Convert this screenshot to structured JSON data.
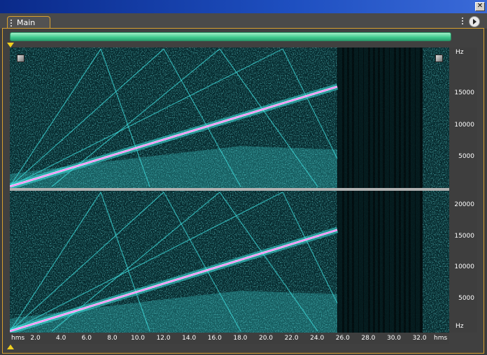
{
  "window": {
    "close_glyph": "✕"
  },
  "tabs": [
    {
      "label": "Main"
    }
  ],
  "colors": {
    "accent": "#d8a030",
    "overview": "#3ec88c",
    "spectro_bg": "#052226",
    "signal": "#3fe0e0",
    "sweep": "#ff60ff"
  },
  "icons": {
    "close": "close-icon",
    "panel_menu": "play-circle-icon",
    "grip": "grip-icon"
  },
  "frequency_axis": {
    "unit": "Hz",
    "top_channel": [
      "15000",
      "10000",
      "5000"
    ],
    "bottom_channel": [
      "20000",
      "15000",
      "10000",
      "5000"
    ]
  },
  "time_axis": {
    "unit_left": "hms",
    "unit_right": "hms",
    "ticks": [
      "2.0",
      "4.0",
      "6.0",
      "8.0",
      "10.0",
      "12.0",
      "14.0",
      "16.0",
      "18.0",
      "20.0",
      "22.0",
      "24.0",
      "26.0",
      "28.0",
      "30.0",
      "32.0"
    ]
  }
}
